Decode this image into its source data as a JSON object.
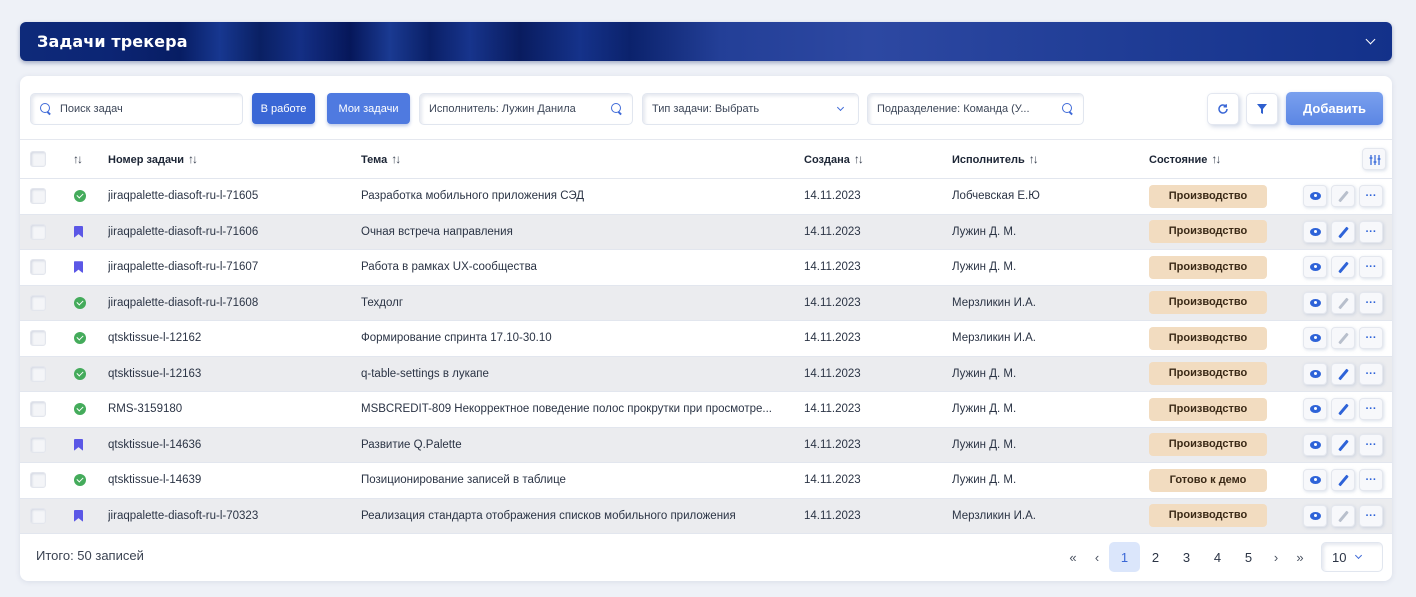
{
  "header": {
    "title": "Задачи трекера",
    "collapse_icon": "chevron-down-icon"
  },
  "toolbar": {
    "search_placeholder": "Поиск задач",
    "chip_in_work": "В работе",
    "chip_my_tasks": "Мои задачи",
    "assignee_filter": "Исполнитель: Лужин Данила",
    "task_type_filter": "Тип задачи: Выбрать",
    "department_filter": "Подразделение: Команда (У...",
    "refresh_icon": "refresh-icon",
    "filter_icon": "filter-icon",
    "add_label": "Добавить"
  },
  "table": {
    "columns": {
      "type": "",
      "number": "Номер задачи",
      "topic": "Тема",
      "created": "Создана",
      "assignee": "Исполнитель",
      "state": "Состояние",
      "settings_icon": "column-settings-icon"
    },
    "rows": [
      {
        "icon": "done-icon",
        "number": "jiraqpalette-diasoft-ru-l-71605",
        "topic": "Разработка мобильного приложения СЭД",
        "created": "14.11.2023",
        "assignee": "Лобчевская Е.Ю",
        "state": "Производство",
        "edit_enabled": false
      },
      {
        "icon": "bookmark-icon",
        "number": "jiraqpalette-diasoft-ru-l-71606",
        "topic": "Очная встреча направления",
        "created": "14.11.2023",
        "assignee": "Лужин Д. М.",
        "state": "Производство",
        "edit_enabled": true
      },
      {
        "icon": "bookmark-icon",
        "number": "jiraqpalette-diasoft-ru-l-71607",
        "topic": "Работа в рамках UX-сообщества",
        "created": "14.11.2023",
        "assignee": "Лужин Д. М.",
        "state": "Производство",
        "edit_enabled": true
      },
      {
        "icon": "done-icon",
        "number": "jiraqpalette-diasoft-ru-l-71608",
        "topic": "Техдолг",
        "created": "14.11.2023",
        "assignee": "Мерзликин И.А.",
        "state": "Производство",
        "edit_enabled": false
      },
      {
        "icon": "done-icon",
        "number": "qtsktissue-l-12162",
        "topic": "Формирование спринта 17.10-30.10",
        "created": "14.11.2023",
        "assignee": "Мерзликин И.А.",
        "state": "Производство",
        "edit_enabled": false
      },
      {
        "icon": "done-icon",
        "number": "qtsktissue-l-12163",
        "topic": "q-table-settings в лукапе",
        "created": "14.11.2023",
        "assignee": "Лужин Д. М.",
        "state": "Производство",
        "edit_enabled": true
      },
      {
        "icon": "done-icon",
        "number": "RMS-3159180",
        "topic": "MSBCREDIT-809 Некорректное поведение полос прокрутки при просмотре...",
        "created": "14.11.2023",
        "assignee": "Лужин Д. М.",
        "state": "Производство",
        "edit_enabled": true
      },
      {
        "icon": "bookmark-icon",
        "number": "qtsktissue-l-14636",
        "topic": "Развитие Q.Palette",
        "created": "14.11.2023",
        "assignee": "Лужин Д. М.",
        "state": "Производство",
        "edit_enabled": true
      },
      {
        "icon": "done-icon",
        "number": "qtsktissue-l-14639",
        "topic": "Позиционирование записей в таблице",
        "created": "14.11.2023",
        "assignee": "Лужин Д. М.",
        "state": "Готово к демо",
        "edit_enabled": true
      },
      {
        "icon": "bookmark-icon",
        "number": "jiraqpalette-diasoft-ru-l-70323",
        "topic": "Реализация стандарта отображения списков мобильного приложения",
        "created": "14.11.2023",
        "assignee": "Мерзликин И.А.",
        "state": "Производство",
        "edit_enabled": false
      }
    ]
  },
  "footer": {
    "total": "Итого: 50 записей",
    "pages": [
      "1",
      "2",
      "3",
      "4",
      "5"
    ],
    "current_page": "1",
    "first": "«",
    "prev": "‹",
    "next": "›",
    "last": "»",
    "per_page": "10"
  },
  "colors": {
    "accent": "#3a67d6",
    "header_bg": "#0e2a7a",
    "badge_bg": "#f2dcc0",
    "done": "#44ab5b",
    "bookmark": "#5b57e6"
  }
}
